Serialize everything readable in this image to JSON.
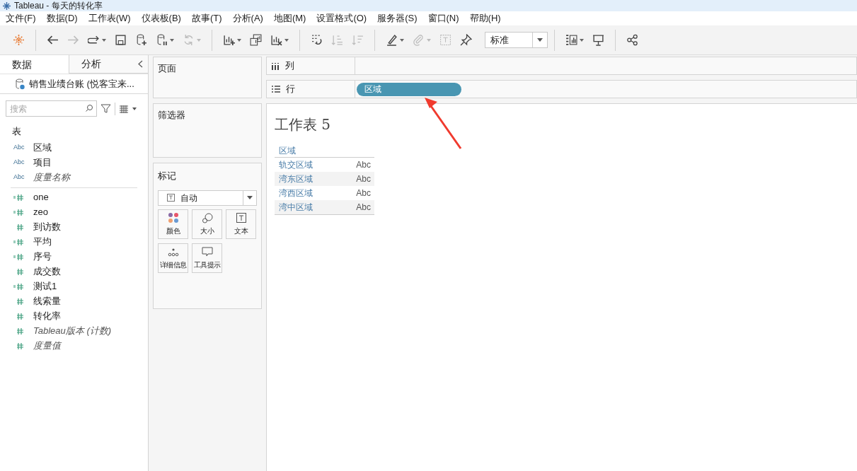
{
  "window": {
    "title": "Tableau - 每天的转化率"
  },
  "menu": [
    "文件(F)",
    "数据(D)",
    "工作表(W)",
    "仪表板(B)",
    "故事(T)",
    "分析(A)",
    "地图(M)",
    "设置格式(O)",
    "服务器(S)",
    "窗口(N)",
    "帮助(H)"
  ],
  "toolbar": [
    {
      "kind": "logo"
    },
    {
      "kind": "sep"
    },
    {
      "kind": "back"
    },
    {
      "kind": "forward",
      "disabled": true
    },
    {
      "kind": "redo",
      "dropdown": true
    },
    {
      "kind": "save"
    },
    {
      "kind": "add-data"
    },
    {
      "kind": "pause-data",
      "dropdown": true
    },
    {
      "kind": "refresh",
      "disabled": true,
      "dropdown": true
    },
    {
      "kind": "sep"
    },
    {
      "kind": "new-sheet",
      "dropdown": true
    },
    {
      "kind": "duplicate"
    },
    {
      "kind": "clear-sheet",
      "dropdown": true
    },
    {
      "kind": "sep"
    },
    {
      "kind": "swap"
    },
    {
      "kind": "sort-asc",
      "disabled": true
    },
    {
      "kind": "sort-desc",
      "disabled": true
    },
    {
      "kind": "sep"
    },
    {
      "kind": "highlight",
      "dropdown": true
    },
    {
      "kind": "attach",
      "disabled": true,
      "dropdown": true
    },
    {
      "kind": "label",
      "disabled": true
    },
    {
      "kind": "pin"
    },
    {
      "kind": "fit",
      "value": "标准"
    },
    {
      "kind": "sep"
    },
    {
      "kind": "show-me",
      "dropdown": true
    },
    {
      "kind": "presentation"
    },
    {
      "kind": "sep"
    },
    {
      "kind": "share"
    }
  ],
  "sidebar": {
    "tabs": [
      {
        "label": "数据",
        "selected": true
      },
      {
        "label": "分析",
        "selected": false
      }
    ],
    "datasource": "销售业绩台账 (悦客宝来...",
    "search": {
      "placeholder": "搜索"
    },
    "section": "表",
    "fields": [
      {
        "kind": "dimension",
        "badge": "Abc",
        "name": "区域",
        "italic": false
      },
      {
        "kind": "dimension",
        "badge": "Abc",
        "name": "项目",
        "italic": false
      },
      {
        "kind": "dimension",
        "badge": "Abc",
        "name": "度量名称",
        "italic": true
      },
      {
        "kind": "measure",
        "calculated": true,
        "name": "one",
        "italic": false
      },
      {
        "kind": "measure",
        "calculated": true,
        "name": "zeo",
        "italic": false
      },
      {
        "kind": "measure",
        "calculated": false,
        "name": "到访数",
        "italic": false
      },
      {
        "kind": "measure",
        "calculated": true,
        "name": "平均",
        "italic": false
      },
      {
        "kind": "measure",
        "calculated": true,
        "name": "序号",
        "italic": false
      },
      {
        "kind": "measure",
        "calculated": false,
        "name": "成交数",
        "italic": false
      },
      {
        "kind": "measure",
        "calculated": true,
        "name": "测试1",
        "italic": false
      },
      {
        "kind": "measure",
        "calculated": false,
        "name": "线索量",
        "italic": false
      },
      {
        "kind": "measure",
        "calculated": false,
        "name": "转化率",
        "italic": false
      },
      {
        "kind": "measure",
        "calculated": false,
        "name": "Tableau版本 (计数)",
        "italic": true
      },
      {
        "kind": "measure",
        "calculated": false,
        "name": "度量值",
        "italic": true
      }
    ]
  },
  "cards": {
    "pages": "页面",
    "filters": "筛选器",
    "marks": {
      "title": "标记",
      "type": "自动",
      "buttons": [
        {
          "kind": "color",
          "label": "颜色"
        },
        {
          "kind": "size",
          "label": "大小"
        },
        {
          "kind": "text",
          "label": "文本"
        },
        {
          "kind": "detail",
          "label": "详细信息"
        },
        {
          "kind": "tooltip",
          "label": "工具提示"
        }
      ]
    }
  },
  "shelves": {
    "columns": {
      "label": "列"
    },
    "rows": {
      "label": "行",
      "pills": [
        "区域"
      ]
    }
  },
  "view": {
    "title": "工作表 5",
    "table": {
      "columns": [
        "区域"
      ],
      "rows": [
        [
          "轨交区域",
          "Abc"
        ],
        [
          "湾东区域",
          "Abc"
        ],
        [
          "湾西区域",
          "Abc"
        ],
        [
          "湾中区域",
          "Abc"
        ]
      ]
    }
  }
}
